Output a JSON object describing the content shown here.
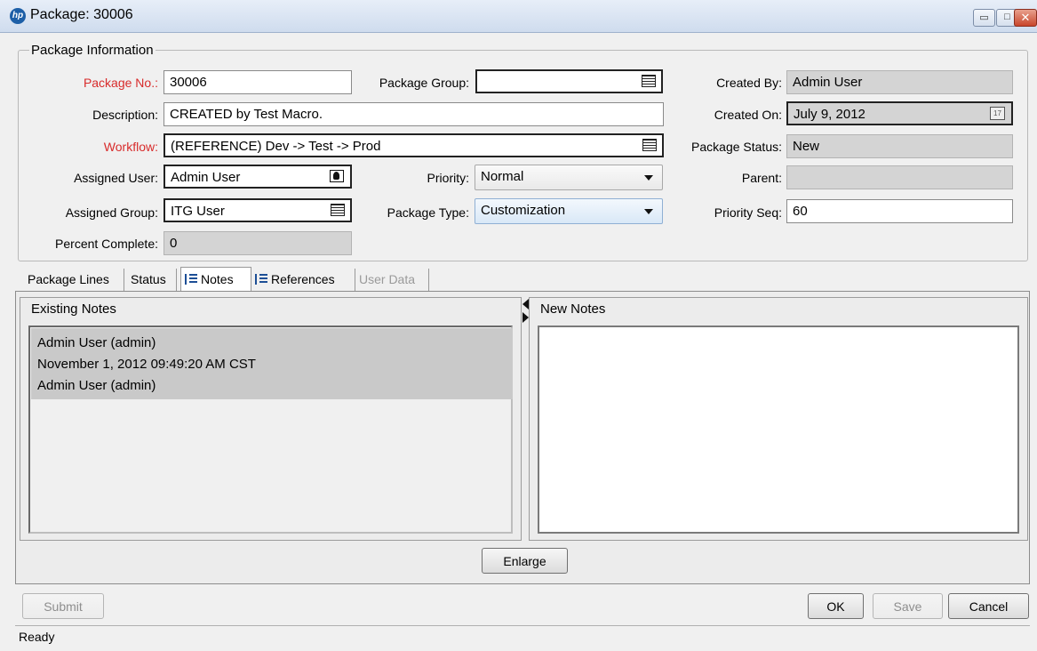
{
  "window": {
    "title": "Package: 30006",
    "app_icon_label": "hp",
    "controls": {
      "minimize": "▭",
      "maximize": "□",
      "close": "✕"
    }
  },
  "package_info": {
    "legend": "Package Information",
    "package_no": {
      "label": "Package No.:",
      "value": "30006"
    },
    "package_group": {
      "label": "Package Group:",
      "value": ""
    },
    "created_by": {
      "label": "Created By:",
      "value": "Admin User"
    },
    "description": {
      "label": "Description:",
      "value": "CREATED by Test Macro."
    },
    "created_on": {
      "label": "Created On:",
      "value": "July 9, 2012",
      "icon": "calendar-icon",
      "icon_text": "17"
    },
    "workflow": {
      "label": "Workflow:",
      "value": "(REFERENCE) Dev -> Test -> Prod"
    },
    "package_status": {
      "label": "Package Status:",
      "value": "New"
    },
    "assigned_user": {
      "label": "Assigned User:",
      "value": "Admin User"
    },
    "priority": {
      "label": "Priority:",
      "value": "Normal"
    },
    "parent": {
      "label": "Parent:",
      "value": ""
    },
    "assigned_group": {
      "label": "Assigned Group:",
      "value": "ITG User"
    },
    "package_type": {
      "label": "Package Type:",
      "value": "Customization"
    },
    "priority_seq": {
      "label": "Priority Seq:",
      "value": "60"
    },
    "percent_complete": {
      "label": "Percent Complete:",
      "value": "0"
    }
  },
  "tabs": [
    {
      "label": "Package Lines",
      "state": "normal"
    },
    {
      "label": "Status",
      "state": "normal"
    },
    {
      "label": "Notes",
      "state": "active"
    },
    {
      "label": "References",
      "state": "normal"
    },
    {
      "label": "User Data",
      "state": "disabled"
    }
  ],
  "notes": {
    "existing_title": "Existing Notes",
    "new_title": "New Notes",
    "existing_entry": {
      "author": "Admin User (admin)",
      "timestamp": "November 1, 2012 09:49:20 AM CST",
      "body": "Admin User (admin)"
    },
    "enlarge_label": "Enlarge"
  },
  "footer": {
    "submit_label": "Submit",
    "ok_label": "OK",
    "save_label": "Save",
    "cancel_label": "Cancel",
    "status_text": "Ready"
  }
}
